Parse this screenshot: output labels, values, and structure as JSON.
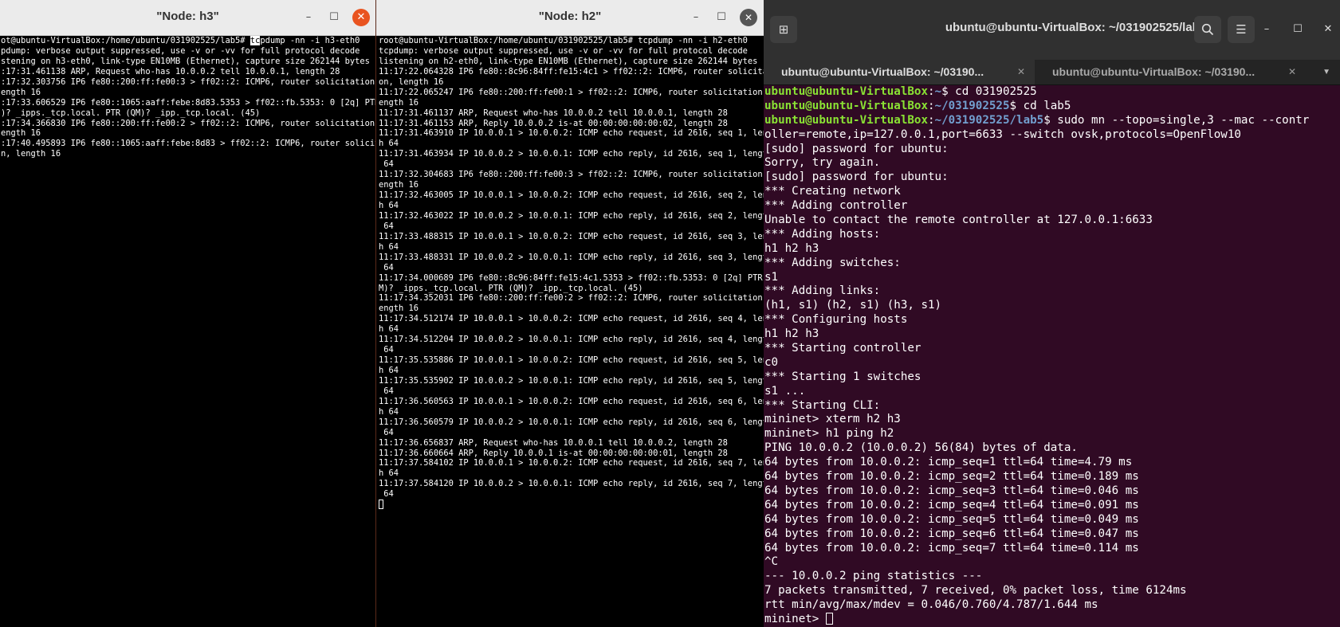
{
  "h3": {
    "title": "\"Node: h3\"",
    "lines": [
      {
        "pre": "ot@ubuntu-VirtualBox:/home/ubuntu/031902525/lab5# ",
        "sel": "tc",
        "post": "pdump -nn -i h3-eth0"
      },
      "pdump: verbose output suppressed, use -v or -vv for full protocol decode",
      "stening on h3-eth0, link-type EN10MB (Ethernet), capture size 262144 bytes",
      ":17:31.461138 ARP, Request who-has 10.0.0.2 tell 10.0.0.1, length 28",
      ":17:32.303756 IP6 fe80::200:ff:fe00:3 > ff02::2: ICMP6, router solicitation, l",
      "ength 16",
      ":17:33.606529 IP6 fe80::1065:aaff:febe:8d83.5353 > ff02::fb.5353: 0 [2q] PTR (",
      ")? _ipps._tcp.local. PTR (QM)? _ipp._tcp.local. (45)",
      ":17:34.366830 IP6 fe80::200:ff:fe00:2 > ff02::2: ICMP6, router solicitation, l",
      "ength 16",
      ":17:40.495893 IP6 fe80::1065:aaff:febe:8d83 > ff02::2: ICMP6, router solicitat",
      "n, length 16"
    ]
  },
  "h2": {
    "title": "\"Node: h2\"",
    "lines": [
      "root@ubuntu-VirtualBox:/home/ubuntu/031902525/lab5# tcpdump -nn -i h2-eth0",
      "tcpdump: verbose output suppressed, use -v or -vv for full protocol decode",
      "listening on h2-eth0, link-type EN10MB (Ethernet), capture size 262144 bytes",
      "11:17:22.064328 IP6 fe80::8c96:84ff:fe15:4c1 > ff02::2: ICMP6, router solicitati",
      "on, length 16",
      "11:17:22.065247 IP6 fe80::200:ff:fe00:1 > ff02::2: ICMP6, router solicitation, l",
      "ength 16",
      "11:17:31.461137 ARP, Request who-has 10.0.0.2 tell 10.0.0.1, length 28",
      "11:17:31.461153 ARP, Reply 10.0.0.2 is-at 00:00:00:00:00:02, length 28",
      "11:17:31.463910 IP 10.0.0.1 > 10.0.0.2: ICMP echo request, id 2616, seq 1, lengt",
      "h 64",
      "11:17:31.463934 IP 10.0.0.2 > 10.0.0.1: ICMP echo reply, id 2616, seq 1, length",
      " 64",
      "11:17:32.304683 IP6 fe80::200:ff:fe00:3 > ff02::2: ICMP6, router solicitation, l",
      "ength 16",
      "11:17:32.463005 IP 10.0.0.1 > 10.0.0.2: ICMP echo request, id 2616, seq 2, lengt",
      "h 64",
      "11:17:32.463022 IP 10.0.0.2 > 10.0.0.1: ICMP echo reply, id 2616, seq 2, length",
      " 64",
      "11:17:33.488315 IP 10.0.0.1 > 10.0.0.2: ICMP echo request, id 2616, seq 3, lengt",
      "h 64",
      "11:17:33.488331 IP 10.0.0.2 > 10.0.0.1: ICMP echo reply, id 2616, seq 3, length",
      " 64",
      "11:17:34.000689 IP6 fe80::8c96:84ff:fe15:4c1.5353 > ff02::fb.5353: 0 [2q] PTR (Q",
      "M)? _ipps._tcp.local. PTR (QM)? _ipp._tcp.local. (45)",
      "11:17:34.352031 IP6 fe80::200:ff:fe00:2 > ff02::2: ICMP6, router solicitation, l",
      "ength 16",
      "11:17:34.512174 IP 10.0.0.1 > 10.0.0.2: ICMP echo request, id 2616, seq 4, lengt",
      "h 64",
      "11:17:34.512204 IP 10.0.0.2 > 10.0.0.1: ICMP echo reply, id 2616, seq 4, length",
      " 64",
      "11:17:35.535886 IP 10.0.0.1 > 10.0.0.2: ICMP echo request, id 2616, seq 5, lengt",
      "h 64",
      "11:17:35.535902 IP 10.0.0.2 > 10.0.0.1: ICMP echo reply, id 2616, seq 5, length",
      " 64",
      "11:17:36.560563 IP 10.0.0.1 > 10.0.0.2: ICMP echo request, id 2616, seq 6, lengt",
      "h 64",
      "11:17:36.560579 IP 10.0.0.2 > 10.0.0.1: ICMP echo reply, id 2616, seq 6, length",
      " 64",
      "11:17:36.656837 ARP, Request who-has 10.0.0.1 tell 10.0.0.2, length 28",
      "11:17:36.660664 ARP, Reply 10.0.0.1 is-at 00:00:00:00:00:01, length 28",
      "11:17:37.584102 IP 10.0.0.1 > 10.0.0.2: ICMP echo request, id 2616, seq 7, lengt",
      "h 64",
      "11:17:37.584120 IP 10.0.0.2 > 10.0.0.1: ICMP echo reply, id 2616, seq 7, length",
      " 64"
    ]
  },
  "gterm": {
    "title": "ubuntu@ubuntu-VirtualBox: ~/031902525/lab5",
    "tabs": [
      {
        "label": "ubuntu@ubuntu-VirtualBox: ~/03190...",
        "close": "✕"
      },
      {
        "label": "ubuntu@ubuntu-VirtualBox: ~/03190...",
        "close": "✕"
      }
    ],
    "prompt_user": "ubuntu@ubuntu-VirtualBox",
    "lines": [
      {
        "user": "ubuntu@ubuntu-VirtualBox",
        "sep": ":",
        "path": "~",
        "cmd": "$ cd 031902525"
      },
      {
        "user": "ubuntu@ubuntu-VirtualBox",
        "sep": ":",
        "path": "~/031902525",
        "cmd": "$ cd lab5"
      },
      {
        "user": "ubuntu@ubuntu-VirtualBox",
        "sep": ":",
        "path": "~/031902525/lab5",
        "cmd": "$ sudo mn --topo=single,3 --mac --contr"
      },
      "oller=remote,ip=127.0.0.1,port=6633 --switch ovsk,protocols=OpenFlow10",
      "[sudo] password for ubuntu:",
      "Sorry, try again.",
      "[sudo] password for ubuntu:",
      "*** Creating network",
      "*** Adding controller",
      "Unable to contact the remote controller at 127.0.0.1:6633",
      "*** Adding hosts:",
      "h1 h2 h3",
      "*** Adding switches:",
      "s1",
      "*** Adding links:",
      "(h1, s1) (h2, s1) (h3, s1)",
      "*** Configuring hosts",
      "h1 h2 h3",
      "*** Starting controller",
      "c0",
      "*** Starting 1 switches",
      "s1 ...",
      "*** Starting CLI:",
      "mininet> xterm h2 h3",
      "mininet> h1 ping h2",
      "PING 10.0.0.2 (10.0.0.2) 56(84) bytes of data.",
      "64 bytes from 10.0.0.2: icmp_seq=1 ttl=64 time=4.79 ms",
      "64 bytes from 10.0.0.2: icmp_seq=2 ttl=64 time=0.189 ms",
      "64 bytes from 10.0.0.2: icmp_seq=3 ttl=64 time=0.046 ms",
      "64 bytes from 10.0.0.2: icmp_seq=4 ttl=64 time=0.091 ms",
      "64 bytes from 10.0.0.2: icmp_seq=5 ttl=64 time=0.049 ms",
      "64 bytes from 10.0.0.2: icmp_seq=6 ttl=64 time=0.047 ms",
      "64 bytes from 10.0.0.2: icmp_seq=7 ttl=64 time=0.114 ms",
      "^C",
      "--- 10.0.0.2 ping statistics ---",
      "7 packets transmitted, 7 received, 0% packet loss, time 6124ms",
      "rtt min/avg/max/mdev = 0.046/0.760/4.787/1.644 ms"
    ],
    "final_prompt": "mininet> "
  },
  "icons": {
    "minimize": "–",
    "maximize": "☐",
    "close": "✕",
    "new_tab": "⊞",
    "search": "🔍",
    "menu": "☰",
    "tab_menu": "▼"
  },
  "colors": {
    "close_accent": "#e95420",
    "terminal_bg": "#300a24",
    "prompt_user": "#8ae234",
    "prompt_path": "#729fcf"
  }
}
